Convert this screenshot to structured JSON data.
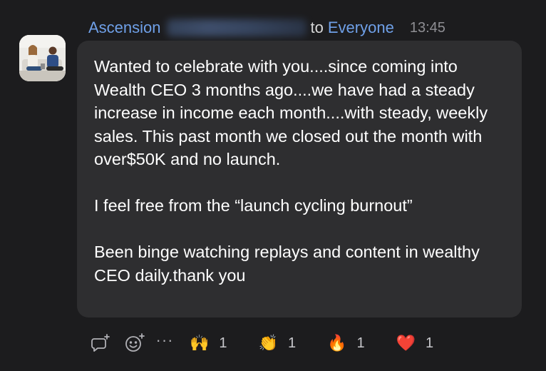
{
  "message": {
    "sender": "Ascension",
    "to_label": "to",
    "recipient": "Everyone",
    "time": "13:45",
    "paragraphs": [
      "Wanted to celebrate with you....since coming into Wealth CEO 3 months ago....we have had a steady increase in income each month....with steady, weekly sales. This past month we closed out the month with over$50K and no launch.",
      "I feel free from the “launch cycling burnout”",
      "Been binge watching replays and content in wealthy CEO daily.thank you"
    ]
  },
  "actions": {
    "more_label": "···",
    "icons": [
      "reply-icon",
      "add-reaction-icon",
      "more-icon"
    ]
  },
  "reactions": [
    {
      "emoji": "🙌",
      "name": "raised-hands",
      "count": "1"
    },
    {
      "emoji": "👏",
      "name": "clapping-hands",
      "count": "1"
    },
    {
      "emoji": "🔥",
      "name": "fire",
      "count": "1"
    },
    {
      "emoji": "❤️",
      "name": "heart",
      "count": "1"
    }
  ]
}
